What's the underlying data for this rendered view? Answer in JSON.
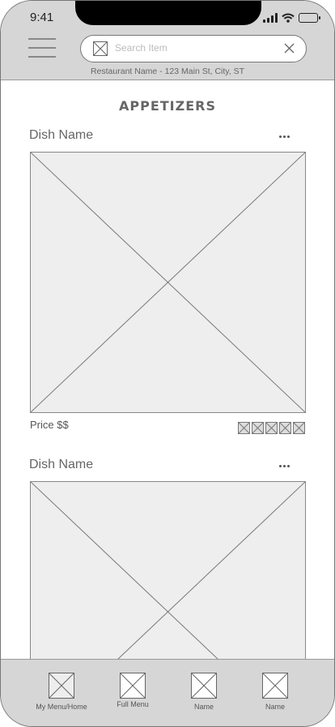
{
  "status_bar": {
    "time": "9:41"
  },
  "header": {
    "menu_icon": "hamburger-icon",
    "search": {
      "placeholder": "Search Item",
      "value": "",
      "image_icon": "image-placeholder-icon",
      "clear_icon": "close-icon"
    },
    "restaurant_info": "Restaurant Name - 123 Main St, City, ST"
  },
  "main": {
    "section_title": "APPETIZERS",
    "dishes": [
      {
        "name": "Dish Name",
        "price": "Price  $$",
        "rating_icons": 5,
        "more_icon": "more-dots-icon"
      },
      {
        "name": "Dish Name",
        "more_icon": "more-dots-icon"
      }
    ]
  },
  "bottom_nav": {
    "items": [
      {
        "label": "My Menu/Home",
        "icon": "image-placeholder-icon"
      },
      {
        "label": "Full Menu",
        "icon": "image-placeholder-icon"
      },
      {
        "label": "Name",
        "icon": "image-placeholder-icon"
      },
      {
        "label": "Name",
        "icon": "image-placeholder-icon"
      }
    ]
  },
  "colors": {
    "bar_background": "#d6d6d6",
    "placeholder_fill": "#eeeeee",
    "stroke": "#777777"
  }
}
